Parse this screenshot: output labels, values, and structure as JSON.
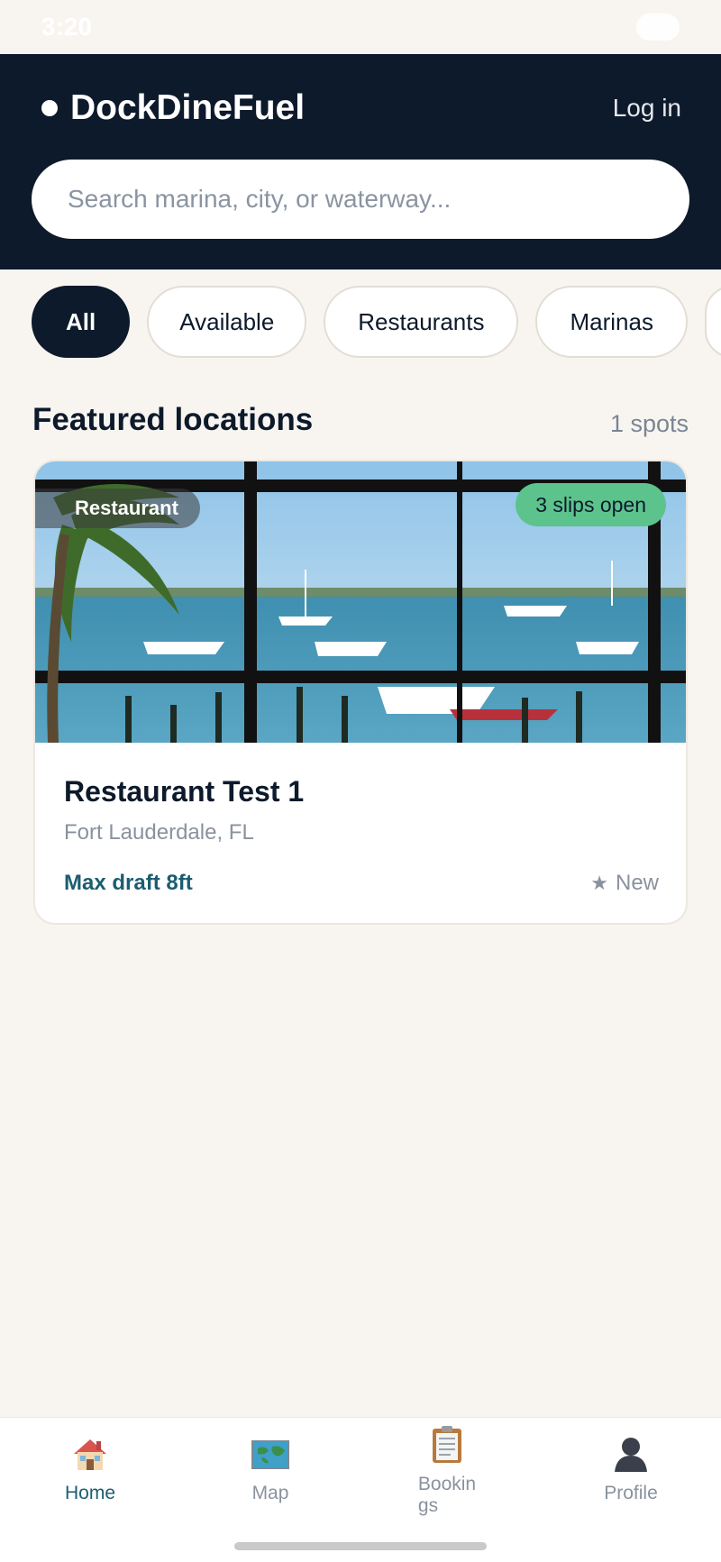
{
  "status_bar": {
    "time": "3:20"
  },
  "header": {
    "brand": "DockDineFuel",
    "login_label": "Log in",
    "search_placeholder": "Search marina, city, or waterway..."
  },
  "filters": {
    "chips": [
      "All",
      "Available",
      "Restaurants",
      "Marinas"
    ],
    "active": "All"
  },
  "section": {
    "title": "Featured locations",
    "count": "1 spots"
  },
  "listing": {
    "type_badge": "Restaurant",
    "availability_badge": "3 slips open",
    "name": "Restaurant Test 1",
    "location": "Fort Lauderdale, FL",
    "draft": "Max draft 8ft",
    "rating": "New",
    "rating_icon": "star-icon"
  },
  "bottom_nav": {
    "items": [
      {
        "label": "Home",
        "icon": "house-icon",
        "active": true
      },
      {
        "label": "Map",
        "icon": "map-icon",
        "active": false
      },
      {
        "label": "Bookin\ngs",
        "icon": "clipboard-icon",
        "active": false
      },
      {
        "label": "Profile",
        "icon": "person-icon",
        "active": false
      }
    ]
  },
  "colors": {
    "navy": "#0d1a2b",
    "background": "#f8f5f0",
    "accent_teal": "#1b5d70",
    "badge_green": "#5cc38c"
  }
}
